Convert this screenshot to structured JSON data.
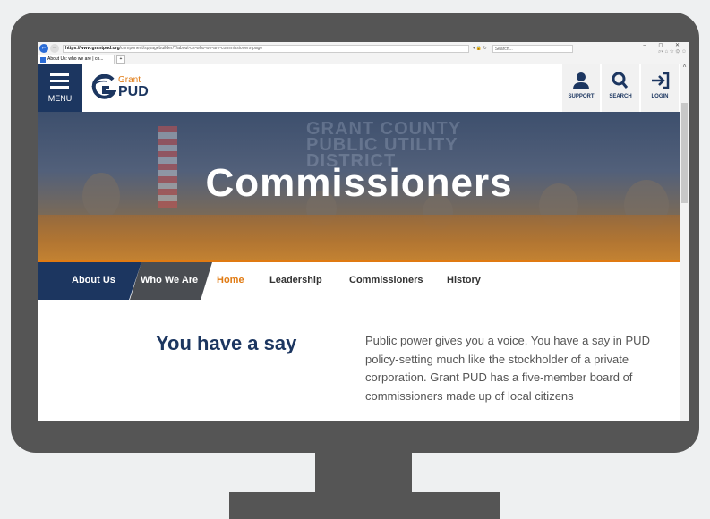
{
  "browser": {
    "url_domain": "https://www.grantpud.org",
    "url_path": "/component/sppagebuilder/?/about-us-who-we-are-commissioners-page",
    "search_placeholder": "Search...",
    "tab_title": "About Us: who we are | co...",
    "window_controls": "– ◻ ✕"
  },
  "header": {
    "menu_label": "MENU",
    "logo_top": "Grant",
    "logo_bottom": "PUD",
    "buttons": [
      {
        "label": "SUPPORT",
        "icon": "person-icon"
      },
      {
        "label": "SEARCH",
        "icon": "search-icon"
      },
      {
        "label": "LOGIN",
        "icon": "login-icon"
      }
    ]
  },
  "hero": {
    "title": "Commissioners",
    "wall_text_line1": "GRANT COUNTY",
    "wall_text_line2": "PUBLIC UTILITY",
    "wall_text_line3": "DISTRICT"
  },
  "subnav": {
    "items": [
      "About Us",
      "Who We Are",
      "Home",
      "Leadership",
      "Commissioners",
      "History"
    ],
    "active": "Home"
  },
  "content": {
    "heading": "You have a say",
    "paragraph": "Public power gives you a voice. You have a say in PUD policy-setting much like the stockholder of a private corporation. Grant PUD has a five-member board of commissioners made up of local citizens"
  },
  "colors": {
    "navy": "#1c3660",
    "orange": "#e07a12",
    "monitor": "#555555"
  }
}
